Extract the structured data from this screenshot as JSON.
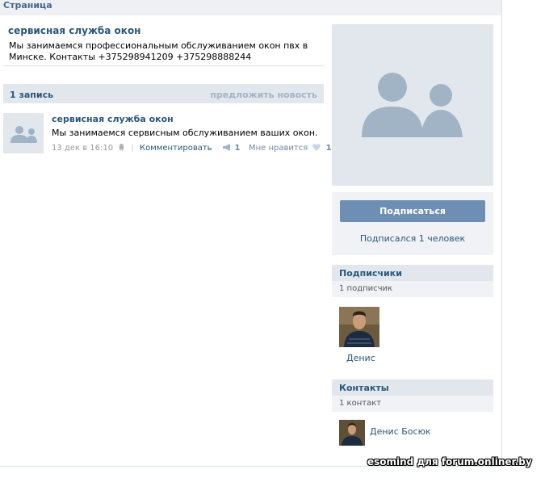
{
  "header": {
    "title": "Страница"
  },
  "page": {
    "name": "сервисная служба окон",
    "description": "Мы занимаемся профессиональным обслуживанием окон пвх в Минске. Контакты +375298941209 +375298888244"
  },
  "wall": {
    "count_label": "1 запись",
    "suggest_label": "предложить новость"
  },
  "post": {
    "author": "сервисная служба окон",
    "text": "Мы занимаемся сервисным обслуживанием ваших окон.",
    "date": "13 дек в 16:10",
    "comment_label": "Комментировать",
    "shares": "1",
    "like_label": "Мне нравится",
    "likes": "1"
  },
  "subscribe": {
    "button_label": "Подписаться",
    "count_text": "Подписался 1 человек"
  },
  "followers": {
    "title": "Подписчики",
    "count_text": "1 подписчик",
    "items": [
      {
        "name": "Денис"
      }
    ]
  },
  "contacts": {
    "title": "Контакты",
    "count_text": "1 контакт",
    "items": [
      {
        "name": "Денис Босюк"
      }
    ]
  },
  "watermark": "esomind для forum.onliner.by",
  "colors": {
    "link": "#2b587a",
    "button": "#6d8fb3",
    "panel": "#e1e7ed",
    "header": "#45688e"
  }
}
